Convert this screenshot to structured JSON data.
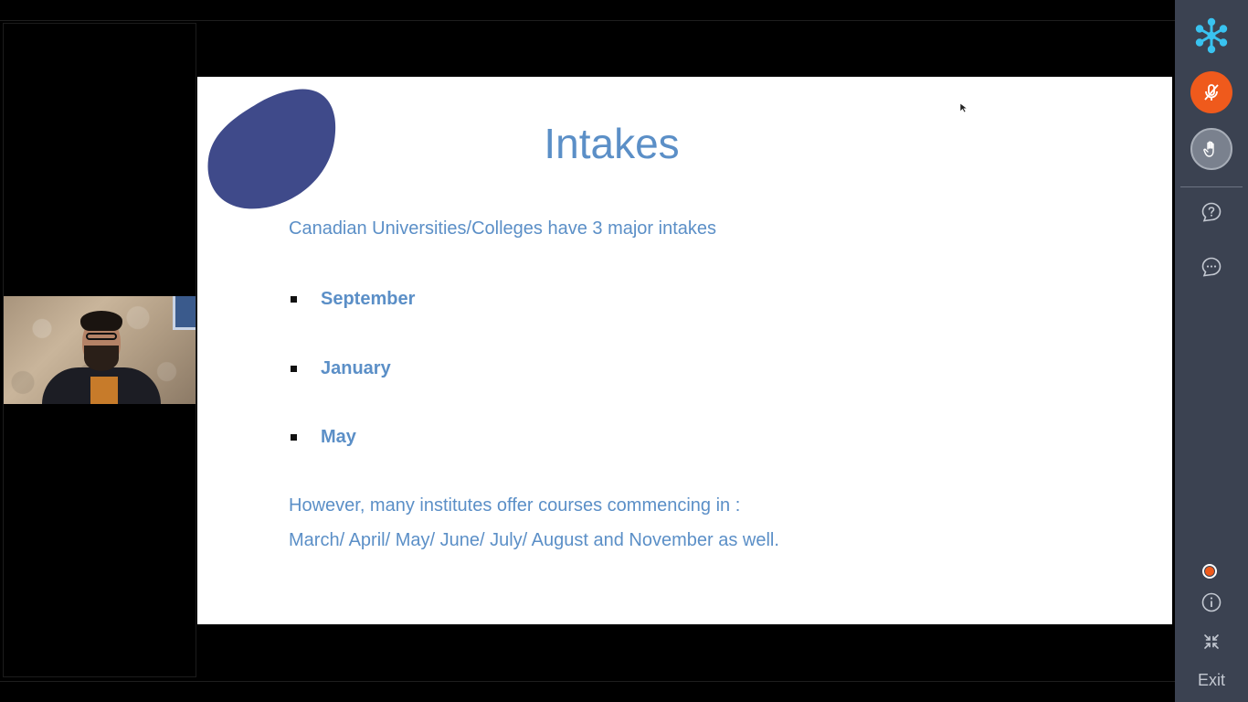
{
  "slide": {
    "title": "Intakes",
    "intro": "Canadian Universities/Colleges have 3 major intakes",
    "bullets": [
      "September",
      "January",
      "May"
    ],
    "note_line1": "However, many institutes offer courses commencing in :",
    "note_line2": "March/ April/ May/ June/ July/ August and November as well."
  },
  "sidebar": {
    "exit_label": "Exit",
    "icons": [
      "app-logo-icon",
      "mic-muted-icon",
      "raise-hand-icon",
      "help-icon",
      "chat-icon",
      "recording-indicator-icon",
      "info-icon",
      "minimize-icon"
    ]
  },
  "colors": {
    "accent_text": "#5b8fc7",
    "blob": "#3f4a8a",
    "mic_active": "#ef5a1c",
    "sidebar_bg": "#3b4251",
    "logo": "#39c3f0"
  }
}
